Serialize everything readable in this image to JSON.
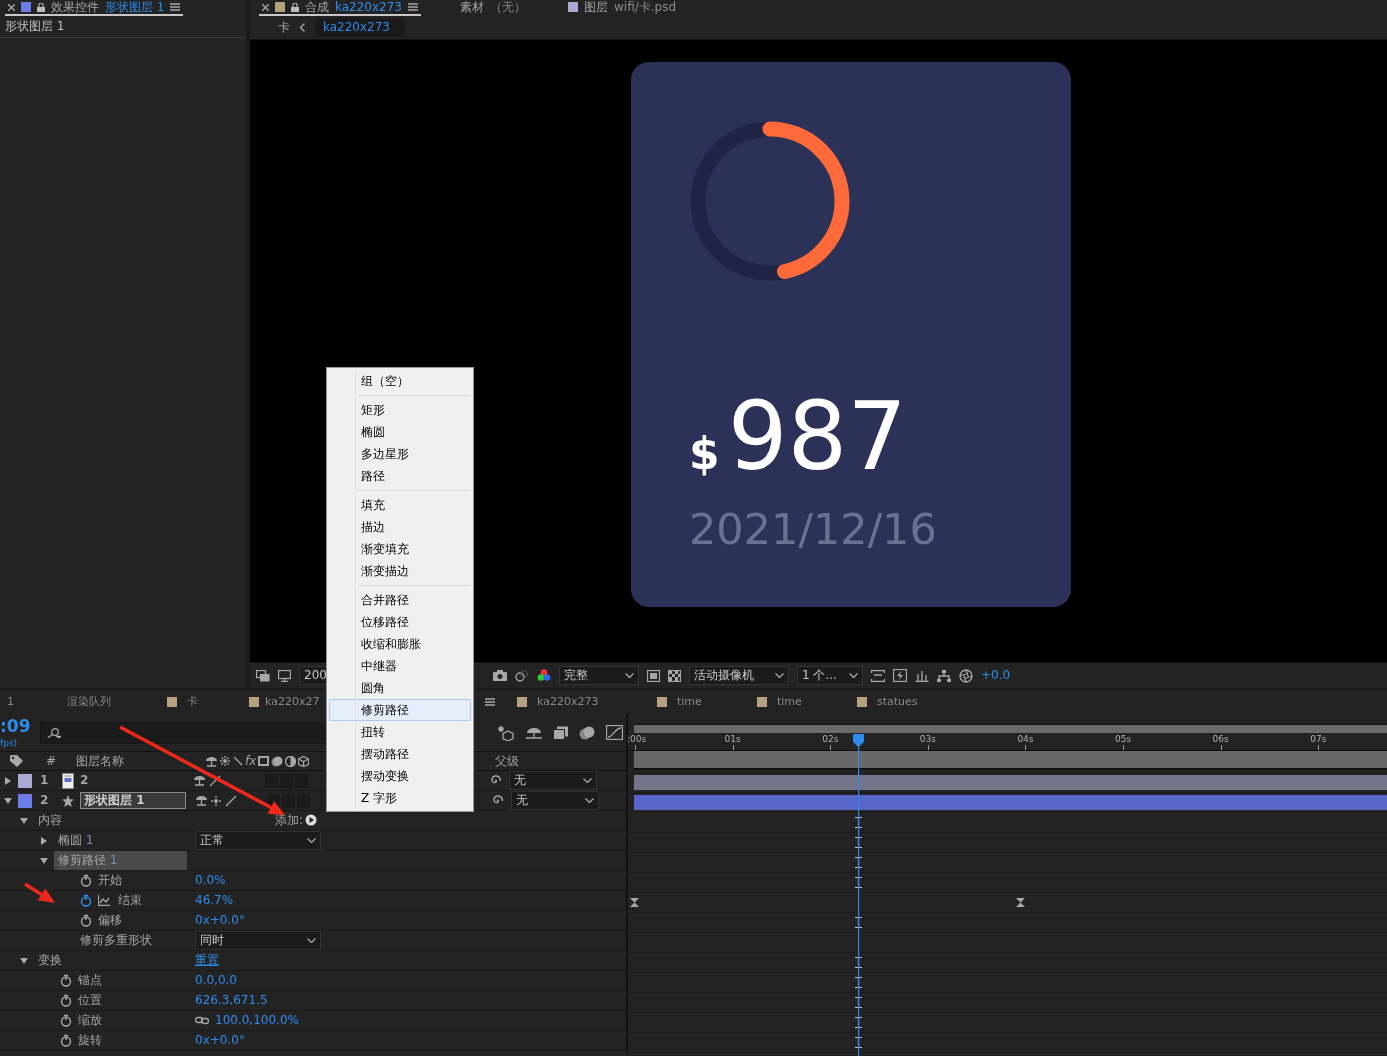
{
  "effects_panel": {
    "tab": {
      "panel": "效果控件",
      "target": "形状图层 1",
      "color": "#6e7ce8",
      "selected": true
    },
    "layer_title": "形状图层 1"
  },
  "composition_panel": {
    "tabs": [
      {
        "panel": "合成",
        "target": "ka220x273",
        "color": "#b5a27e",
        "selected": true
      },
      {
        "panel": "素材",
        "target": "（无）",
        "selected": false
      },
      {
        "panel": "图层",
        "target": "wifi/卡.psd",
        "color": "#a9a9d4",
        "selected": false
      }
    ],
    "breadcrumbs": [
      {
        "label": "卡",
        "selected": false
      },
      {
        "label": "ka220x273",
        "selected": true
      }
    ],
    "card": {
      "currency": "$",
      "amount": "987",
      "date": "2021/12/16"
    },
    "toolbar": {
      "zoom": "200",
      "resolution": "完整",
      "camera": "活动摄像机",
      "views": "1 个...",
      "exposure": "+0.0"
    }
  },
  "timeline": {
    "tabs": [
      {
        "label": "1",
        "selected": false
      },
      {
        "label": "渲染队列",
        "selected": false
      },
      {
        "label": "卡",
        "color": "#b5a27e",
        "selected": false
      },
      {
        "label": "ka220x27",
        "color": "#b5a27e",
        "selected": true
      },
      {
        "label": "ka220x273",
        "color": "#b5a27e",
        "selected": false
      },
      {
        "label": "time",
        "color": "#b5a27e",
        "selected": false
      },
      {
        "label": "time",
        "color": "#b5a27e",
        "selected": false
      },
      {
        "label": "statues",
        "color": "#b5a27e",
        "selected": false
      }
    ],
    "timecode": ":09",
    "fps": "fps)",
    "columns": {
      "index": "#",
      "name": "图层名称",
      "effects": "fx",
      "parent": "父级"
    },
    "ruler": [
      ":00s",
      "01s",
      "02s",
      "03s",
      "04s",
      "05s",
      "06s",
      "07s"
    ],
    "layers": [
      {
        "index": "1",
        "name": "2",
        "kind": "footage",
        "color": "#a9a9d4",
        "expanded": false,
        "selected": false,
        "parent": "无"
      },
      {
        "index": "2",
        "name": "形状图层 1",
        "kind": "shape",
        "color": "#6e7ce8",
        "expanded": true,
        "selected": true,
        "parent": "无"
      }
    ],
    "properties": [
      {
        "kind": "group",
        "label": "内容",
        "expanded": true,
        "selected": false,
        "action": "添加:",
        "children": [
          {
            "kind": "group",
            "label": "椭圆",
            "number": "1",
            "expanded": false,
            "selected": false,
            "mode": "正常"
          },
          {
            "kind": "group",
            "label": "修剪路径",
            "number": "1",
            "expanded": true,
            "selected": true,
            "children": [
              {
                "kind": "property",
                "label": "开始",
                "value": "0.0%",
                "animated": false
              },
              {
                "kind": "property",
                "label": "结束",
                "value": "46.7%",
                "animated": true
              },
              {
                "kind": "property",
                "label": "偏移",
                "value": "0x+0.0°",
                "animated": false
              },
              {
                "kind": "option",
                "label": "修剪多重形状",
                "value": "同时"
              }
            ]
          }
        ]
      },
      {
        "kind": "group",
        "label": "变换",
        "expanded": true,
        "selected": false,
        "link": "重置",
        "children": [
          {
            "kind": "property",
            "label": "锚点",
            "value": "0.0,0.0",
            "animated": false
          },
          {
            "kind": "property",
            "label": "位置",
            "value": "626.3,671.5",
            "animated": false
          },
          {
            "kind": "property",
            "label": "缩放",
            "value": "100.0,100.0%",
            "animated": false,
            "constrained": true
          },
          {
            "kind": "property",
            "label": "旋转",
            "value": "0x+0.0°",
            "animated": false
          }
        ]
      }
    ]
  },
  "add_menu": {
    "sections": [
      {
        "items": [
          {
            "label": "组（空）",
            "selected": false
          }
        ]
      },
      {
        "items": [
          {
            "label": "矩形",
            "selected": false
          },
          {
            "label": "椭圆",
            "selected": false
          },
          {
            "label": "多边星形",
            "selected": false
          },
          {
            "label": "路径",
            "selected": false
          }
        ]
      },
      {
        "items": [
          {
            "label": "填充",
            "selected": false
          },
          {
            "label": "描边",
            "selected": false
          },
          {
            "label": "渐变填充",
            "selected": false
          },
          {
            "label": "渐变描边",
            "selected": false
          }
        ]
      },
      {
        "items": [
          {
            "label": "合并路径",
            "selected": false
          },
          {
            "label": "位移路径",
            "selected": false
          },
          {
            "label": "收缩和膨胀",
            "selected": false
          },
          {
            "label": "中继器",
            "selected": false
          },
          {
            "label": "圆角",
            "selected": false
          },
          {
            "label": "修剪路径",
            "selected": true
          },
          {
            "label": "扭转",
            "selected": false
          },
          {
            "label": "摆动路径",
            "selected": false
          },
          {
            "label": "摆动变换",
            "selected": false
          },
          {
            "label": "Z 字形",
            "selected": false
          }
        ]
      }
    ]
  }
}
